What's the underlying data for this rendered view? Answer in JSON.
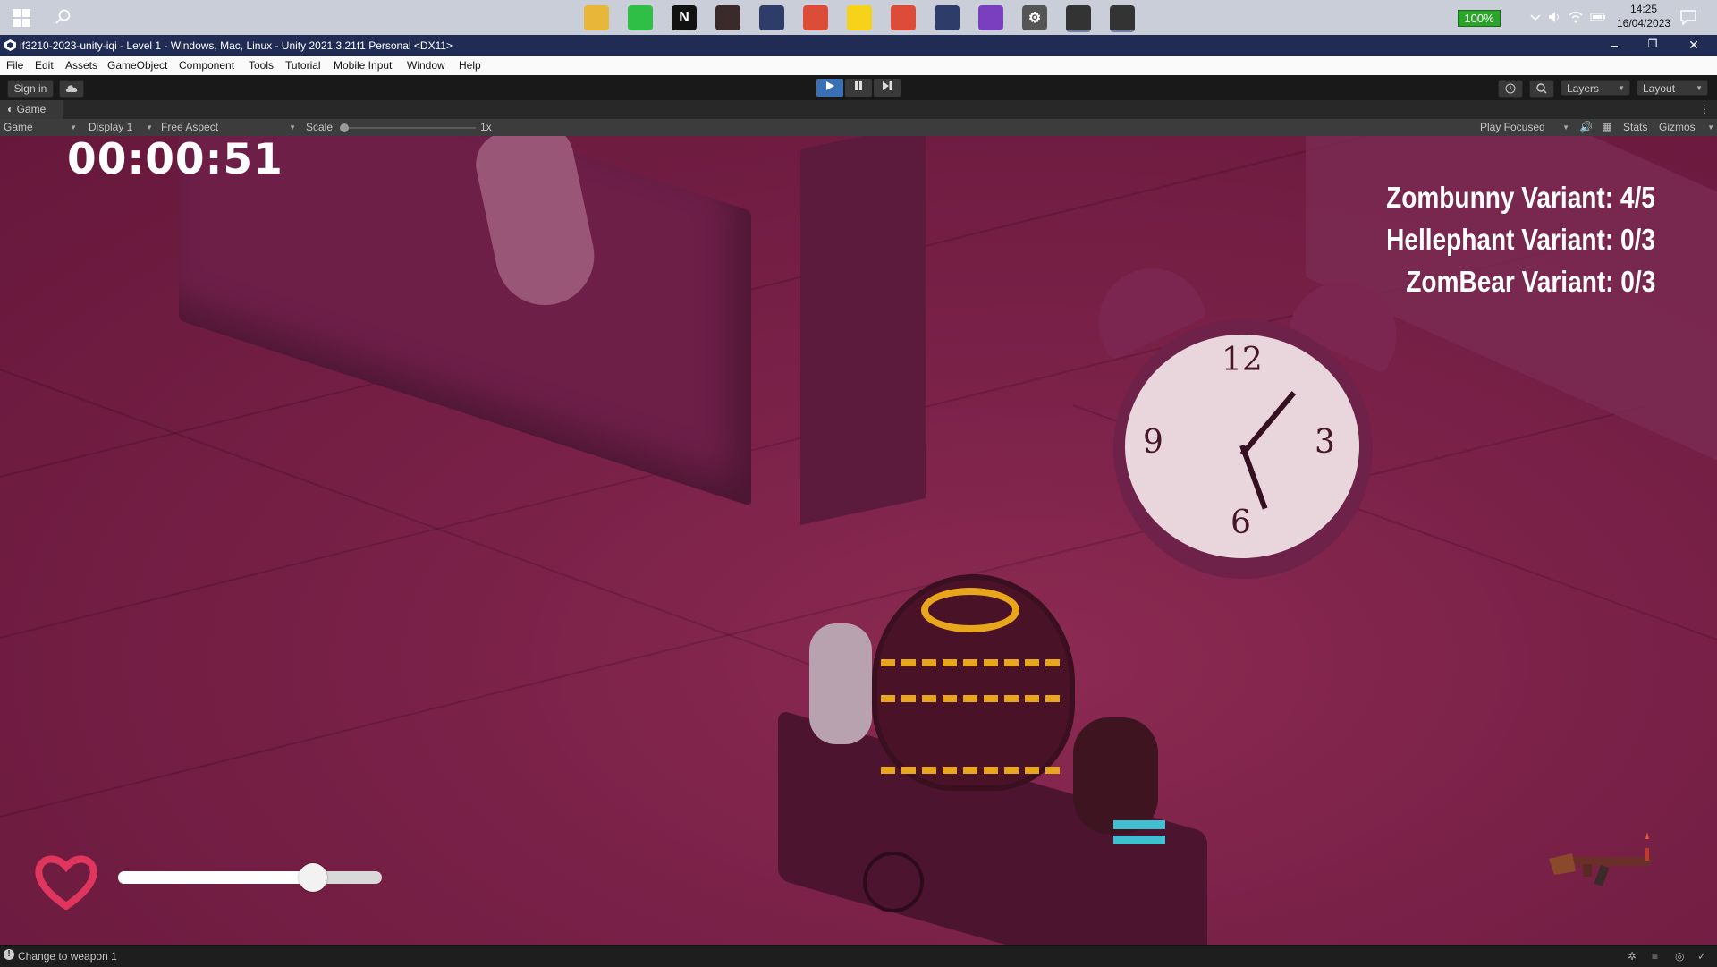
{
  "taskbar": {
    "apps": [
      {
        "name": "file-explorer-icon",
        "color": "#e8b73a"
      },
      {
        "name": "line-icon",
        "color": "#2fbf46"
      },
      {
        "name": "notion-icon",
        "color": "#111111",
        "glyph": "N"
      },
      {
        "name": "character-app-icon",
        "color": "#3a2a2a"
      },
      {
        "name": "anime-app-icon",
        "color": "#2e3c6a"
      },
      {
        "name": "chrome-icon",
        "color": "#dd4b39"
      },
      {
        "name": "sticky-notes-icon",
        "color": "#f7d21a"
      },
      {
        "name": "chrome-profile-icon",
        "color": "#dd4b39"
      },
      {
        "name": "anime-app-2-icon",
        "color": "#2e3c6a"
      },
      {
        "name": "github-desktop-icon",
        "color": "#7a3fbf"
      },
      {
        "name": "settings-icon",
        "color": "#555555",
        "glyph": "⚙"
      },
      {
        "name": "unity-hub-icon",
        "color": "#333333"
      },
      {
        "name": "unity-editor-icon",
        "color": "#333333"
      }
    ],
    "battery": "100%",
    "time": "14:25",
    "date": "16/04/2023"
  },
  "window": {
    "title": "if3210-2023-unity-iqi - Level 1 - Windows, Mac, Linux - Unity 2021.3.21f1 Personal <DX11>"
  },
  "menu": [
    "File",
    "Edit",
    "Assets",
    "GameObject",
    "Component",
    "Tools",
    "Tutorial",
    "Mobile Input",
    "Window",
    "Help"
  ],
  "toolbar": {
    "sign_in": "Sign in",
    "layers": "Layers",
    "layout": "Layout"
  },
  "game_tab": {
    "label": "Game",
    "view_mode": "Game",
    "display": "Display 1",
    "aspect": "Free Aspect",
    "scale_label": "Scale",
    "scale_value": "1x",
    "play_mode": "Play Focused",
    "stats": "Stats",
    "gizmos": "Gizmos"
  },
  "hud": {
    "timer": "00:00:51",
    "variants": [
      "Zombunny Variant: 4/5",
      "Hellephant Variant: 0/3",
      "ZomBear Variant: 0/3"
    ],
    "health_fraction": 0.74
  },
  "clock_numbers": [
    "12",
    "3",
    "6",
    "9"
  ],
  "status": {
    "message": "Change to weapon 1"
  },
  "colors": {
    "tint": "#7a2148",
    "title_bar": "#212c54",
    "accent_play": "#3a6fb4",
    "heart": "#e0365e",
    "helmet_stripe": "#e8a61c"
  }
}
